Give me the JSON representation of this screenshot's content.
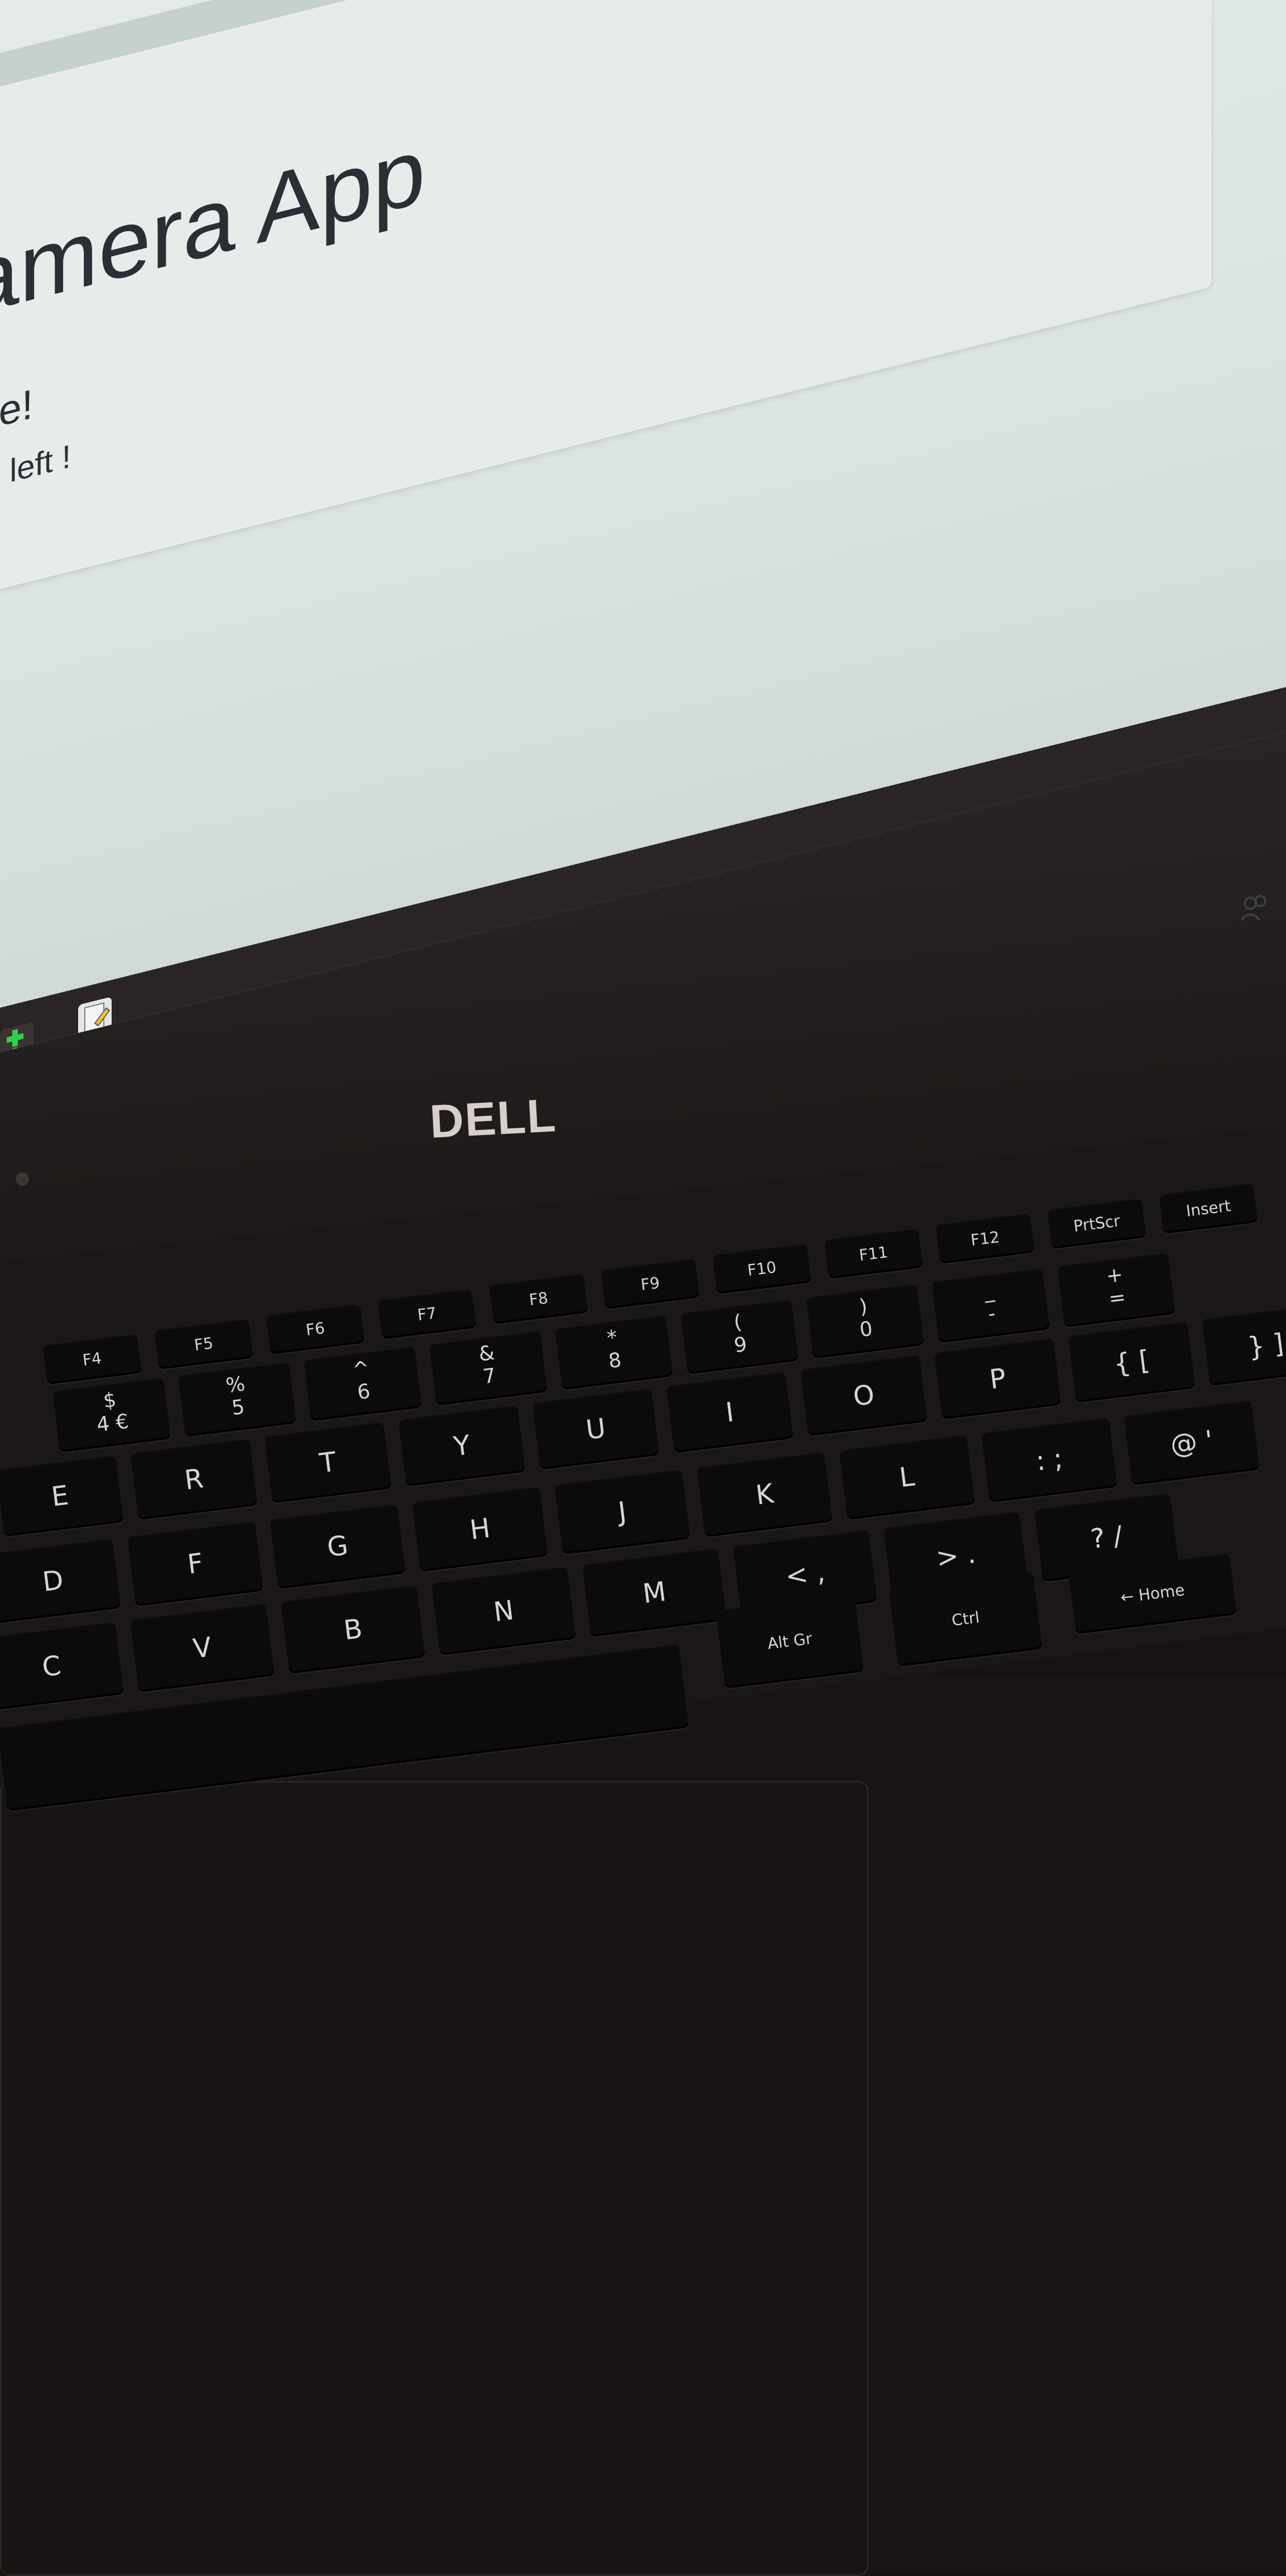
{
  "screen": {
    "app_title": "amera App",
    "line1": "ple!",
    "line2": "es left !"
  },
  "taskbar": {
    "icons": [
      "app-icon-green-plus",
      "notepad-icon"
    ]
  },
  "laptop": {
    "brand": "DELL"
  },
  "keyboard": {
    "fn_row": [
      "F4",
      "F5",
      "F6",
      "F7",
      "F8",
      "F9",
      "F10",
      "F11",
      "F12",
      "PrtScr",
      "Insert"
    ],
    "num_row": [
      {
        "top": "$",
        "bottom": "4 €"
      },
      {
        "top": "%",
        "bottom": "5"
      },
      {
        "top": "^",
        "bottom": "6"
      },
      {
        "top": "&",
        "bottom": "7"
      },
      {
        "top": "*",
        "bottom": "8"
      },
      {
        "top": "(",
        "bottom": "9"
      },
      {
        "top": ")",
        "bottom": "0"
      },
      {
        "top": "_",
        "bottom": "-"
      },
      {
        "top": "+",
        "bottom": "="
      }
    ],
    "top_row": [
      "E",
      "R",
      "T",
      "Y",
      "U",
      "I",
      "O",
      "P",
      "{ [",
      "} ]"
    ],
    "home_row": [
      "D",
      "F",
      "G",
      "H",
      "J",
      "K",
      "L",
      ": ;",
      "@ '"
    ],
    "bottom_row": [
      "C",
      "V",
      "B",
      "N",
      "M",
      "< ,",
      "> .",
      "? /"
    ],
    "mod_row": [
      "Alt Gr",
      "Ctrl",
      "← Home"
    ]
  }
}
